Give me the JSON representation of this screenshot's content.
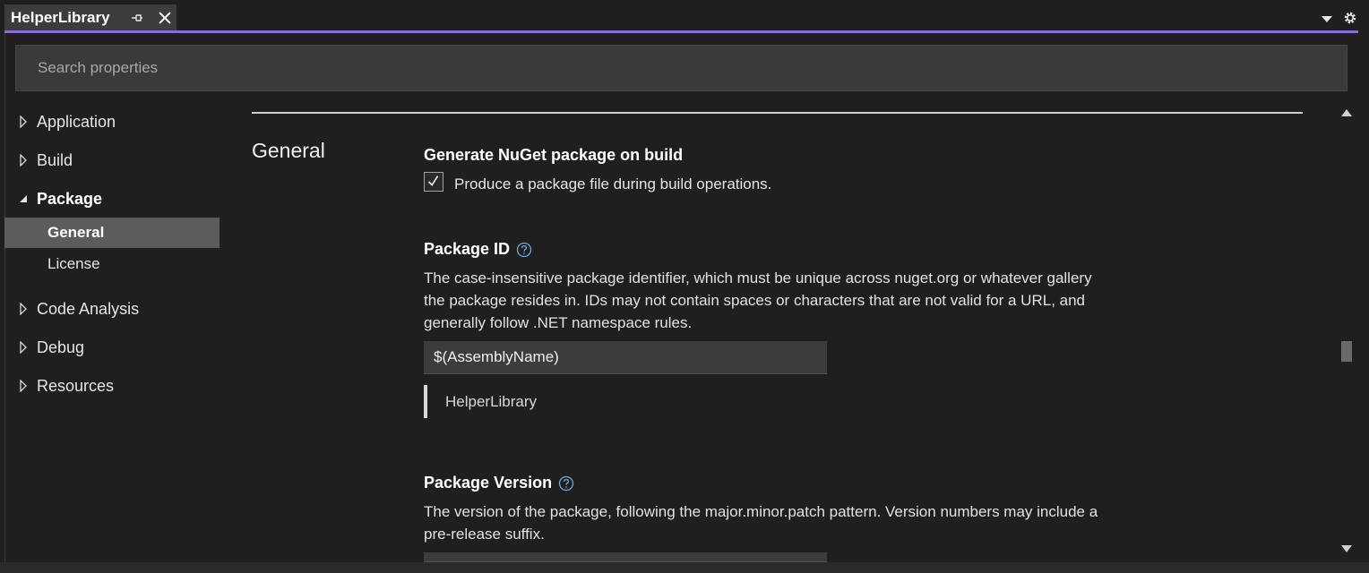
{
  "tab": {
    "title": "HelperLibrary"
  },
  "search": {
    "placeholder": "Search properties"
  },
  "nav": {
    "application": "Application",
    "build": "Build",
    "package": "Package",
    "general": "General",
    "license": "License",
    "code_analysis": "Code Analysis",
    "debug": "Debug",
    "resources": "Resources"
  },
  "main": {
    "section_title": "General",
    "generate": {
      "title": "Generate NuGet package on build",
      "checkbox_label": "Produce a package file during build operations.",
      "checked": true
    },
    "package_id": {
      "title": "Package ID",
      "description": "The case-insensitive package identifier, which must be unique across nuget.org or whatever gallery the package resides in. IDs may not contain spaces or characters that are not valid for a URL, and generally follow .NET namespace rules.",
      "value": "$(AssemblyName)",
      "evaluated": "HelperLibrary"
    },
    "package_version": {
      "title": "Package Version",
      "description": "The version of the package, following the major.minor.patch pattern. Version numbers may include a pre-release suffix."
    }
  },
  "colors": {
    "accent": "#8a6bd8",
    "help_icon": "#6fa8dc",
    "selected_bg": "#5c5c5c"
  }
}
